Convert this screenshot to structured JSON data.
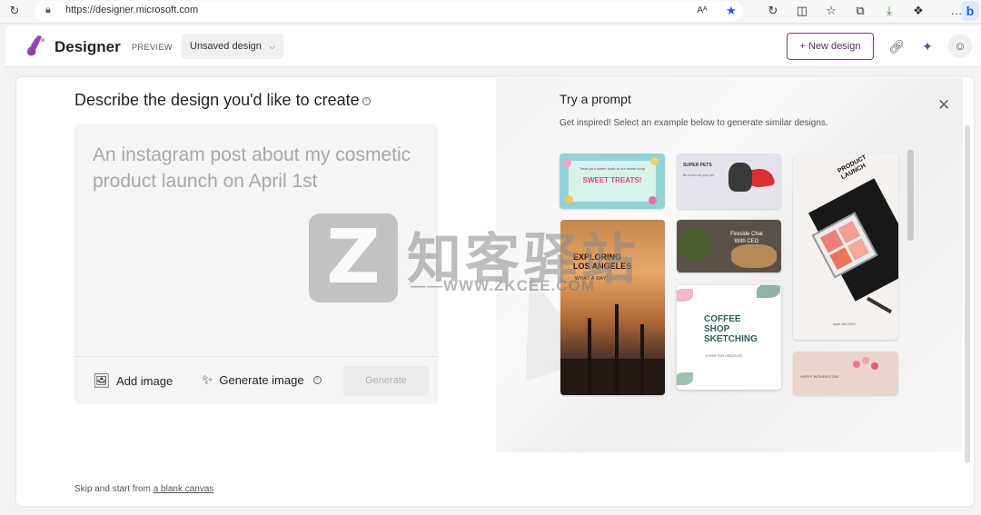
{
  "browser": {
    "url": "https://designer.microsoft.com",
    "toolbar_icons": [
      "read-aloud-icon",
      "favorite-star-icon",
      "refresh-page-icon",
      "split-screen-icon",
      "favorites-icon",
      "collections-icon",
      "downloads-icon",
      "extensions-icon",
      "more-icon"
    ],
    "read_aloud_label": "Aᴬ",
    "more_label": "…"
  },
  "header": {
    "app_name": "Designer",
    "badge": "PREVIEW",
    "doc_name": "Unsaved design",
    "new_design_label": "New design",
    "new_design_plus": "+"
  },
  "main": {
    "heading": "Describe the design you'd like to create",
    "prompt_placeholder": "An instagram post about my cosmetic product launch on April 1st",
    "add_image_label": "Add image",
    "generate_image_label": "Generate image",
    "generate_button_label": "Generate",
    "skip_prefix": "Skip and start from ",
    "skip_link": "a blank canvas"
  },
  "prompts_panel": {
    "title": "Try a prompt",
    "subtitle": "Get inspired! Select an example below to generate similar designs.",
    "thumbnails": [
      {
        "name": "sweet-treats",
        "text": "SWEET TREATS!",
        "small": "Treat your sweet tooth at our sweet shop"
      },
      {
        "name": "super-pets",
        "text": "SUPER PETS",
        "small": "Be a hero for your pet"
      },
      {
        "name": "exploring-la",
        "title_line1": "EXPLORING",
        "title_line2": "LOS ANGELES",
        "sub": "WHAT A DAY!"
      },
      {
        "name": "fireside-chat",
        "line1": "Fireside Chat",
        "line2": "With CEO"
      },
      {
        "name": "product-launch",
        "line1": "PRODUCT",
        "line2": "LAUNCH",
        "date": "April 1st 2023"
      },
      {
        "name": "coffee-shop",
        "line1": "COFFEE",
        "line2": "SHOP",
        "line3": "SKETCHING",
        "sub": "EVENT FOR CREATIVES"
      },
      {
        "name": "womens-day",
        "text": "HAPPY WOMEN'S DAY"
      }
    ]
  },
  "watermark": {
    "logo_letter": "Z",
    "chinese": "知客驿站",
    "url": "——WWW.ZKCEE.COM"
  },
  "colors": {
    "accent": "#7a3e8c",
    "panel_bg": "#f5f5f5",
    "link_blue": "#1a5fd0"
  }
}
